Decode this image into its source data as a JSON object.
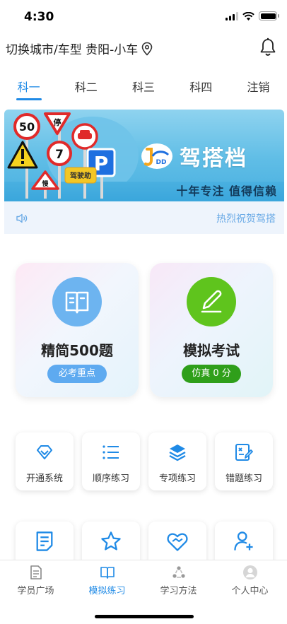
{
  "status": {
    "time": "4:30"
  },
  "header": {
    "city_label": "切换城市/车型 贵阳-小车"
  },
  "tabs": [
    {
      "label": "科一",
      "active": true
    },
    {
      "label": "科二",
      "active": false
    },
    {
      "label": "科三",
      "active": false
    },
    {
      "label": "科四",
      "active": false
    },
    {
      "label": "注销",
      "active": false
    }
  ],
  "banner": {
    "brand": "驾搭档",
    "slogan": "十年专注  值得信赖",
    "signs": {
      "speed": "50",
      "stop": "停",
      "seven": "7",
      "parking": "P",
      "tag": "驾驶助",
      "slow": "慢"
    }
  },
  "notice": {
    "text": "热烈祝贺驾搭"
  },
  "cards": [
    {
      "title": "精简500题",
      "badge": "必考重点",
      "icon": "book-icon"
    },
    {
      "title": "模拟考试",
      "badge": "仿真 0 分",
      "icon": "edit-icon"
    }
  ],
  "grid": [
    {
      "label": "开通系统",
      "icon": "diamond-icon"
    },
    {
      "label": "顺序练习",
      "icon": "list-icon"
    },
    {
      "label": "专项练习",
      "icon": "layers-icon"
    },
    {
      "label": "错题练习",
      "icon": "wrong-note-icon"
    },
    {
      "label": "",
      "icon": "document-icon"
    },
    {
      "label": "",
      "icon": "star-icon"
    },
    {
      "label": "",
      "icon": "handshake-heart-icon"
    },
    {
      "label": "",
      "icon": "add-user-icon"
    }
  ],
  "bottom_nav": [
    {
      "label": "学员广场",
      "icon": "document-icon",
      "active": false
    },
    {
      "label": "模拟练习",
      "icon": "open-book-icon",
      "active": true
    },
    {
      "label": "学习方法",
      "icon": "recycle-icon",
      "active": false
    },
    {
      "label": "个人中心",
      "icon": "person-icon",
      "active": false
    }
  ],
  "colors": {
    "accent": "#1f8ae6",
    "green": "#5fc41d",
    "badge_green": "#2f9f1a"
  }
}
